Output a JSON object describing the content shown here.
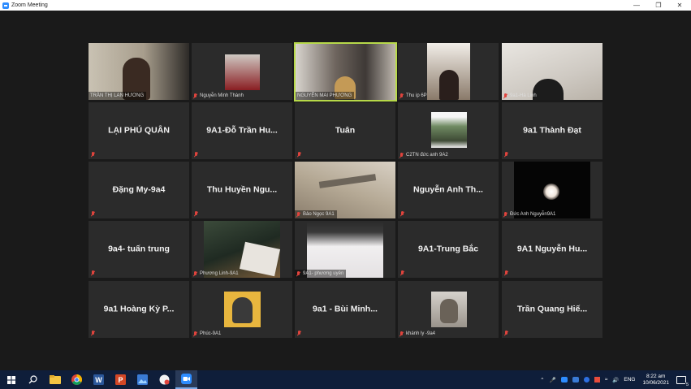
{
  "window": {
    "title": "Zoom Meeting",
    "controls": [
      "—",
      "❐",
      "✕"
    ]
  },
  "participants": [
    {
      "name": "TRẦN THỊ LAN HƯƠNG",
      "video": true,
      "muted": false
    },
    {
      "name": "Nguyễn Minh Thành",
      "video": true,
      "muted": true
    },
    {
      "name": "NGUYỄN MAI PHƯƠNG",
      "video": true,
      "muted": false,
      "active": true
    },
    {
      "name": "Thu ip 6P",
      "video": true,
      "muted": true
    },
    {
      "name": "9a1-Hà Linh",
      "video": true,
      "muted": true
    },
    {
      "name": "LẠI PHÚ QUÂN",
      "video": false,
      "muted": true
    },
    {
      "name": "9A1-Đỗ Trần Hu...",
      "video": false,
      "muted": true
    },
    {
      "name": "Tuân",
      "video": false,
      "muted": true
    },
    {
      "name": "C2TN đức anh 9A2",
      "video": true,
      "muted": true
    },
    {
      "name": "9a1 Thành Đạt",
      "video": false,
      "muted": true
    },
    {
      "name": "Đặng My-9a4",
      "video": false,
      "muted": true
    },
    {
      "name": "Thu Huyền Ngu...",
      "video": false,
      "muted": true
    },
    {
      "name": "Bảo Ngọc 9A1",
      "video": true,
      "muted": true
    },
    {
      "name": "Nguyễn Anh Th...",
      "video": false,
      "muted": true
    },
    {
      "name": "Đức Anh Nguyễn9A1",
      "video": true,
      "muted": true
    },
    {
      "name": "9a4- tuấn trung",
      "video": false,
      "muted": true
    },
    {
      "name": "Phương Linh-9A1",
      "video": true,
      "muted": true
    },
    {
      "name": "9A1- phương uyên",
      "video": true,
      "muted": true
    },
    {
      "name": "9A1-Trung Bắc",
      "video": false,
      "muted": true
    },
    {
      "name": "9A1 Nguyễn Hu...",
      "video": false,
      "muted": true
    },
    {
      "name": "9a1 Hoàng Kỳ P...",
      "video": false,
      "muted": true
    },
    {
      "name": "Phúc-9A1",
      "video": true,
      "muted": true
    },
    {
      "name": "9a1 - Bùi Minh...",
      "video": false,
      "muted": true
    },
    {
      "name": "khánh ly -9a4",
      "video": true,
      "muted": true
    },
    {
      "name": "Trần Quang Hiế...",
      "video": false,
      "muted": true
    }
  ],
  "taskbar": {
    "apps": [
      "start-icon",
      "search-icon",
      "file-explorer-icon",
      "chrome-icon",
      "word-icon",
      "powerpoint-icon",
      "photos-icon",
      "screen-recorder-icon",
      "zoom-icon"
    ],
    "language": "ENG",
    "time": "8:22 am",
    "date": "10/06/2021",
    "notification_count": "5"
  },
  "colors": {
    "active_speaker": "#b7d94a",
    "muted": "#e0443d",
    "taskbar": "#0f1e3a",
    "zoom_blue": "#2d8cff"
  }
}
